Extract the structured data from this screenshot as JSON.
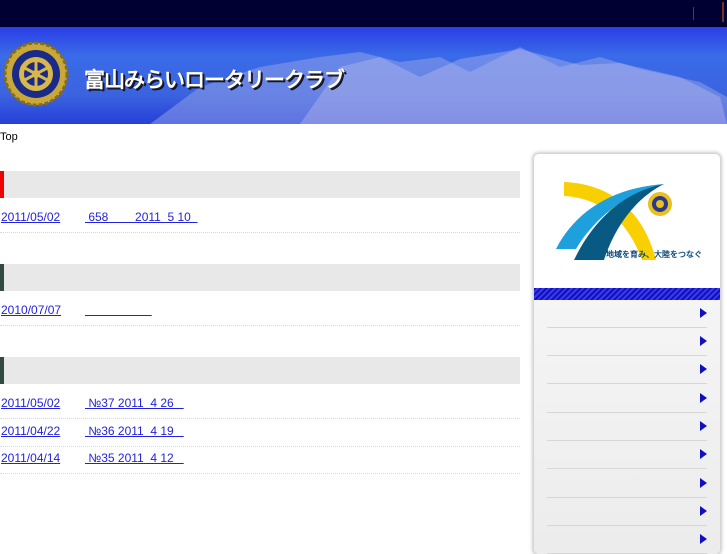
{
  "header": {
    "site_title": "富山みらいロータリークラブ",
    "emblem_text": "ROTARY INTERNATIONAL"
  },
  "breadcrumb": "Top",
  "sections": [
    {
      "rows": [
        {
          "date": "2011/05/02",
          "title": " 658        2011  5 10  "
        }
      ]
    },
    {
      "rows": [
        {
          "date": "2010/07/07",
          "title": "                    "
        }
      ]
    },
    {
      "rows": [
        {
          "date": "2011/05/02",
          "title": " №37 2011  4 26   "
        },
        {
          "date": "2011/04/22",
          "title": " №36 2011  4 19   "
        },
        {
          "date": "2011/04/14",
          "title": " №35 2011  4 12   "
        }
      ]
    }
  ],
  "sidebar": {
    "theme_logo_text": "地域を育み、大陸をつなぐ",
    "nav_count": 9
  },
  "colors": {
    "topbar": "#000033",
    "link": "#2222dd",
    "accent_red": "#ee0000",
    "nav_arrow": "#1010c0"
  }
}
